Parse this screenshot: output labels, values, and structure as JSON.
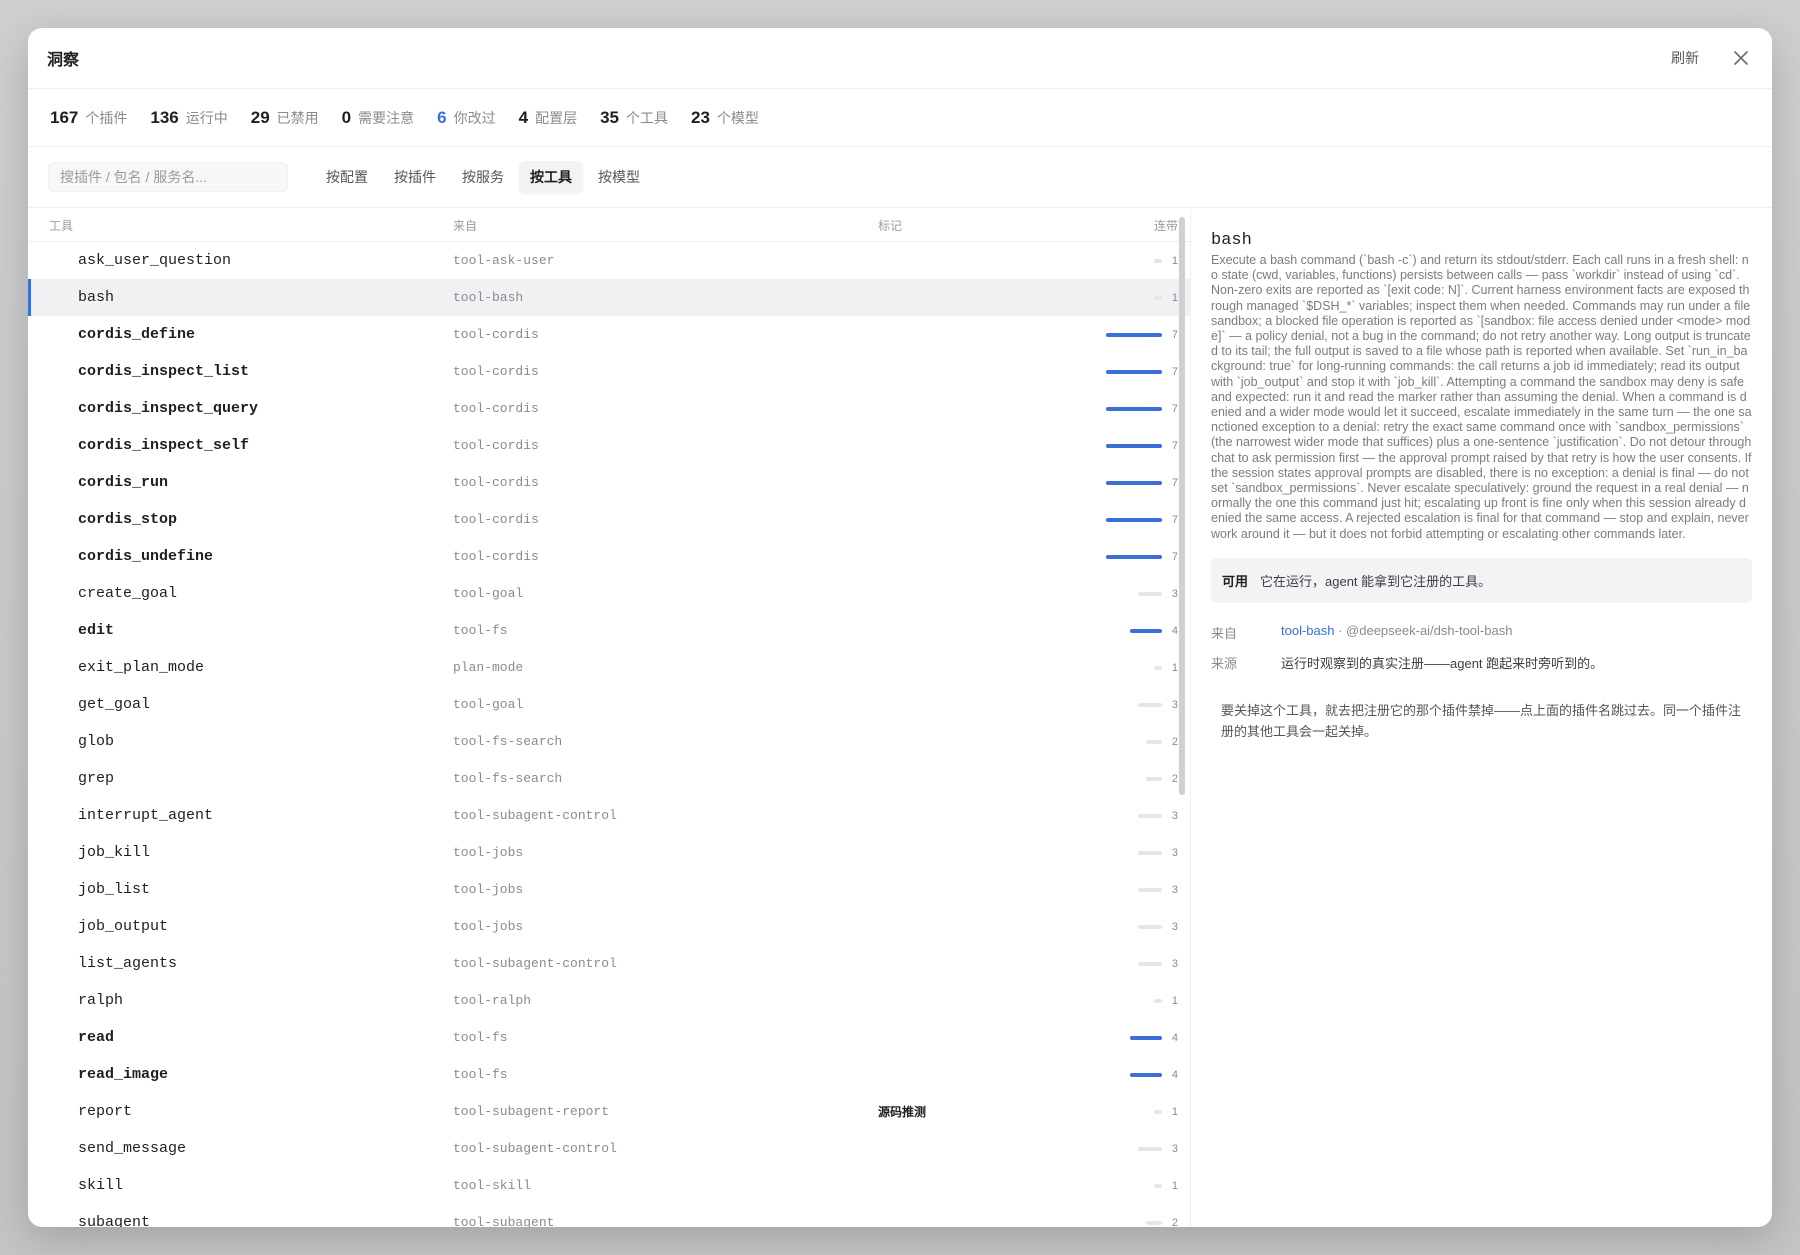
{
  "modal": {
    "title": "洞察",
    "refresh_label": "刷新"
  },
  "stats": [
    {
      "num": "167",
      "label": "个插件",
      "highlight": false
    },
    {
      "num": "136",
      "label": "运行中",
      "highlight": false
    },
    {
      "num": "29",
      "label": "已禁用",
      "highlight": false
    },
    {
      "num": "0",
      "label": "需要注意",
      "highlight": false
    },
    {
      "num": "6",
      "label": "你改过",
      "highlight": true
    },
    {
      "num": "4",
      "label": "配置层",
      "highlight": false
    },
    {
      "num": "35",
      "label": "个工具",
      "highlight": false
    },
    {
      "num": "23",
      "label": "个模型",
      "highlight": false
    }
  ],
  "search": {
    "placeholder": "搜插件 / 包名 / 服务名..."
  },
  "tabs": [
    {
      "label": "按配置",
      "active": false
    },
    {
      "label": "按插件",
      "active": false
    },
    {
      "label": "按服务",
      "active": false
    },
    {
      "label": "按工具",
      "active": true
    },
    {
      "label": "按模型",
      "active": false
    }
  ],
  "columns": {
    "tool": "工具",
    "source": "来自",
    "mark": "标记",
    "count": "连带"
  },
  "rows": [
    {
      "tool": "ask_user_question",
      "source": "tool-ask-user",
      "mark": "",
      "count": 1,
      "bold": false,
      "active": false,
      "selected": false
    },
    {
      "tool": "bash",
      "source": "tool-bash",
      "mark": "",
      "count": 1,
      "bold": false,
      "active": false,
      "selected": true
    },
    {
      "tool": "cordis_define",
      "source": "tool-cordis",
      "mark": "",
      "count": 7,
      "bold": true,
      "active": true,
      "selected": false
    },
    {
      "tool": "cordis_inspect_list",
      "source": "tool-cordis",
      "mark": "",
      "count": 7,
      "bold": true,
      "active": true,
      "selected": false
    },
    {
      "tool": "cordis_inspect_query",
      "source": "tool-cordis",
      "mark": "",
      "count": 7,
      "bold": true,
      "active": true,
      "selected": false
    },
    {
      "tool": "cordis_inspect_self",
      "source": "tool-cordis",
      "mark": "",
      "count": 7,
      "bold": true,
      "active": true,
      "selected": false
    },
    {
      "tool": "cordis_run",
      "source": "tool-cordis",
      "mark": "",
      "count": 7,
      "bold": true,
      "active": true,
      "selected": false
    },
    {
      "tool": "cordis_stop",
      "source": "tool-cordis",
      "mark": "",
      "count": 7,
      "bold": true,
      "active": true,
      "selected": false
    },
    {
      "tool": "cordis_undefine",
      "source": "tool-cordis",
      "mark": "",
      "count": 7,
      "bold": true,
      "active": true,
      "selected": false
    },
    {
      "tool": "create_goal",
      "source": "tool-goal",
      "mark": "",
      "count": 3,
      "bold": false,
      "active": false,
      "selected": false
    },
    {
      "tool": "edit",
      "source": "tool-fs",
      "mark": "",
      "count": 4,
      "bold": true,
      "active": true,
      "selected": false
    },
    {
      "tool": "exit_plan_mode",
      "source": "plan-mode",
      "mark": "",
      "count": 1,
      "bold": false,
      "active": false,
      "selected": false
    },
    {
      "tool": "get_goal",
      "source": "tool-goal",
      "mark": "",
      "count": 3,
      "bold": false,
      "active": false,
      "selected": false
    },
    {
      "tool": "glob",
      "source": "tool-fs-search",
      "mark": "",
      "count": 2,
      "bold": false,
      "active": false,
      "selected": false
    },
    {
      "tool": "grep",
      "source": "tool-fs-search",
      "mark": "",
      "count": 2,
      "bold": false,
      "active": false,
      "selected": false
    },
    {
      "tool": "interrupt_agent",
      "source": "tool-subagent-control",
      "mark": "",
      "count": 3,
      "bold": false,
      "active": false,
      "selected": false
    },
    {
      "tool": "job_kill",
      "source": "tool-jobs",
      "mark": "",
      "count": 3,
      "bold": false,
      "active": false,
      "selected": false
    },
    {
      "tool": "job_list",
      "source": "tool-jobs",
      "mark": "",
      "count": 3,
      "bold": false,
      "active": false,
      "selected": false
    },
    {
      "tool": "job_output",
      "source": "tool-jobs",
      "mark": "",
      "count": 3,
      "bold": false,
      "active": false,
      "selected": false
    },
    {
      "tool": "list_agents",
      "source": "tool-subagent-control",
      "mark": "",
      "count": 3,
      "bold": false,
      "active": false,
      "selected": false
    },
    {
      "tool": "ralph",
      "source": "tool-ralph",
      "mark": "",
      "count": 1,
      "bold": false,
      "active": false,
      "selected": false
    },
    {
      "tool": "read",
      "source": "tool-fs",
      "mark": "",
      "count": 4,
      "bold": true,
      "active": true,
      "selected": false
    },
    {
      "tool": "read_image",
      "source": "tool-fs",
      "mark": "",
      "count": 4,
      "bold": true,
      "active": true,
      "selected": false
    },
    {
      "tool": "report",
      "source": "tool-subagent-report",
      "mark": "源码推测",
      "count": 1,
      "bold": false,
      "active": false,
      "selected": false
    },
    {
      "tool": "send_message",
      "source": "tool-subagent-control",
      "mark": "",
      "count": 3,
      "bold": false,
      "active": false,
      "selected": false
    },
    {
      "tool": "skill",
      "source": "tool-skill",
      "mark": "",
      "count": 1,
      "bold": false,
      "active": false,
      "selected": false
    },
    {
      "tool": "subagent",
      "source": "tool-subagent",
      "mark": "",
      "count": 2,
      "bold": false,
      "active": false,
      "selected": false
    }
  ],
  "detail": {
    "title": "bash",
    "description": "Execute a bash command (`bash -c`) and return its stdout/stderr. Each call runs in a fresh shell: no state (cwd, variables, functions) persists between calls — pass `workdir` instead of using `cd`. Non-zero exits are reported as `[exit code: N]`. Current harness environment facts are exposed through managed `$DSH_*` variables; inspect them when needed. Commands may run under a file sandbox; a blocked file operation is reported as `[sandbox: file access denied under <mode> mode]` — a policy denial, not a bug in the command; do not retry another way. Long output is truncated to its tail; the full output is saved to a file whose path is reported when available. Set `run_in_background: true` for long-running commands: the call returns a job id immediately; read its output with `job_output` and stop it with `job_kill`. Attempting a command the sandbox may deny is safe and expected: run it and read the marker rather than assuming the denial. When a command is denied and a wider mode would let it succeed, escalate immediately in the same turn — the one sanctioned exception to a denial: retry the exact same command once with `sandbox_permissions` (the narrowest wider mode that suffices) plus a one-sentence `justification`. Do not detour through chat to ask permission first — the approval prompt raised by that retry is how the user consents. If the session states approval prompts are disabled, there is no exception: a denial is final — do not set `sandbox_permissions`. Never escalate speculatively: ground the request in a real denial — normally the one this command just hit; escalating up front is fine only when this session already denied the same access. A rejected escalation is final for that command — stop and explain, never work around it — but it does not forbid attempting or escalating other commands later.",
    "status_tag": "可用",
    "status_text": "它在运行，agent 能拿到它注册的工具。",
    "from_key": "来自",
    "from_link": "tool-bash",
    "from_pkg": " · @deepseek-ai/dsh-tool-bash",
    "source_key": "来源",
    "source_val": "运行时观察到的真实注册——agent 跑起来时旁听到的。",
    "note": "要关掉这个工具，就去把注册它的那个插件禁掉——点上面的插件名跳过去。同一个插件注册的其他工具会一起关掉。"
  },
  "colors": {
    "accent": "#3b6fd8",
    "idle_bar": "#e6e6ea"
  },
  "icons": {
    "close": "close-icon"
  }
}
